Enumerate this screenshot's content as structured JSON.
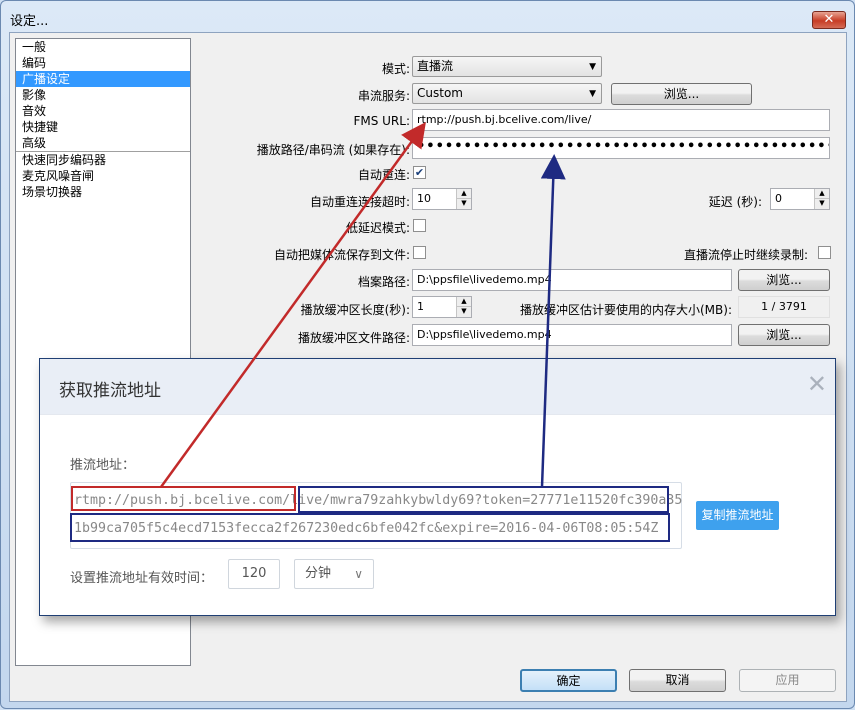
{
  "window": {
    "title": "设定...",
    "close_label": "✕"
  },
  "sidebar": {
    "items": [
      {
        "label": "一般"
      },
      {
        "label": "编码"
      },
      {
        "label": "广播设定",
        "selected": true
      },
      {
        "label": "影像"
      },
      {
        "label": "音效"
      },
      {
        "label": "快捷键"
      },
      {
        "label": "高级"
      },
      {
        "label": "快速同步编码器"
      },
      {
        "label": "麦克风噪音闸"
      },
      {
        "label": "场景切换器"
      }
    ]
  },
  "form": {
    "mode_label": "模式:",
    "mode_value": "直播流",
    "service_label": "串流服务:",
    "service_value": "Custom",
    "browse_label": "浏览...",
    "fms_url_label": "FMS URL:",
    "fms_url_value": "rtmp://push.bj.bcelive.com/live/",
    "play_path_label": "播放路径/串码流 (如果存在):",
    "play_path_value": "••••••••••••••••••••••••••••••••••••••••••••••••••••••••••••••••••••••••••••••••••••",
    "auto_reconnect_label": "自动重连:",
    "auto_reconnect_checked": true,
    "reconnect_timeout_label": "自动重连连接超时:",
    "reconnect_timeout_value": "10",
    "delay_label": "延迟 (秒):",
    "delay_value": "0",
    "low_latency_label": "低延迟模式:",
    "auto_save_label": "自动把媒体流保存到文件:",
    "keep_recording_label": "直播流停止时继续录制:",
    "file_path_label": "档案路径:",
    "file_path_value": "D:\\ppsfile\\livedemo.mp4",
    "buffer_len_label": "播放缓冲区长度(秒):",
    "buffer_len_value": "1",
    "buffer_mem_label": "播放缓冲区估计要使用的内存大小(MB):",
    "buffer_mem_value": "1 / 3791",
    "buffer_file_label": "播放缓冲区文件路径:",
    "buffer_file_value": "D:\\ppsfile\\livedemo.mp4"
  },
  "footer": {
    "ok_label": "确定",
    "cancel_label": "取消",
    "apply_label": "应用"
  },
  "popup": {
    "title": "获取推流地址",
    "close_label": "✕",
    "url_label": "推流地址：",
    "url_line1": "rtmp://push.bj.bcelive.com/live/mwra79zahkybwldy69?token=27771e11520fc390a35",
    "url_line2": "1b99ca705f5c4ecd7153fecca2f267230edc6bfe042fc&expire=2016-04-06T08:05:54Z",
    "copy_label": "复制推流地址",
    "expire_label": "设置推流地址有效时间：",
    "expire_value": "120",
    "unit_value": "分钟",
    "chevron": "∨"
  },
  "colors": {
    "accent": "#3ea1ee",
    "highlight_red": "#c22a2a",
    "highlight_blue": "#1e2a82"
  }
}
